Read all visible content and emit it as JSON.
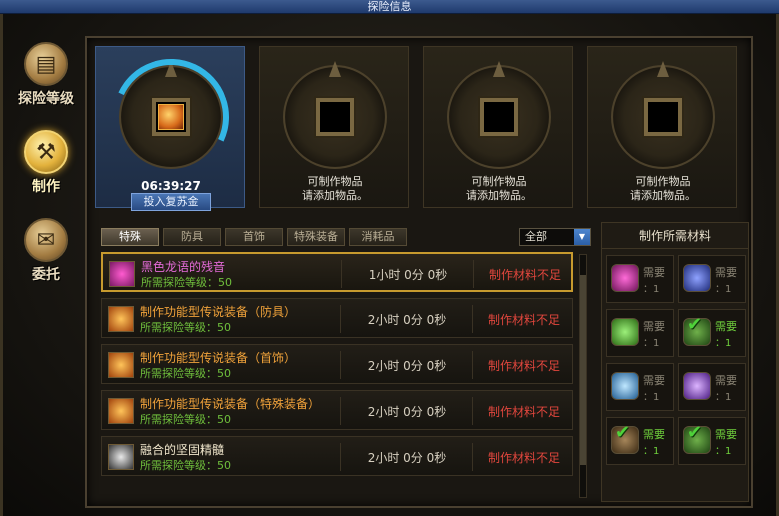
{
  "window": {
    "title": "探险信息"
  },
  "nav": [
    {
      "label": "探险等级",
      "icon": "scroll-icon",
      "active": false
    },
    {
      "label": "制作",
      "icon": "anvil-icon",
      "active": true
    },
    {
      "label": "委托",
      "icon": "envelope-icon",
      "active": false
    }
  ],
  "slots": [
    {
      "timer": "06:39:27",
      "button": "投入复苏金",
      "progress": 0.2
    },
    {
      "msg1": "可制作物品",
      "msg2": "请添加物品。"
    },
    {
      "msg1": "可制作物品",
      "msg2": "请添加物品。"
    },
    {
      "msg1": "可制作物品",
      "msg2": "请添加物品。"
    }
  ],
  "tabs": [
    "特殊",
    "防具",
    "首饰",
    "特殊装备",
    "消耗品"
  ],
  "filter": {
    "value": "全部"
  },
  "recipes": [
    {
      "name": "黑色龙语的残音",
      "level": "所需探险等级：50",
      "time": "1小时 0分 0秒",
      "status": "制作材料不足",
      "color": "#e46bd8"
    },
    {
      "name": "制作功能型传说装备（防具）",
      "level": "所需探险等级：50",
      "time": "2小时 0分 0秒",
      "status": "制作材料不足",
      "color": "#f0a23a"
    },
    {
      "name": "制作功能型传说装备（首饰）",
      "level": "所需探险等级：50",
      "time": "2小时 0分 0秒",
      "status": "制作材料不足",
      "color": "#f0a23a"
    },
    {
      "name": "制作功能型传说装备（特殊装备）",
      "level": "所需探险等级：50",
      "time": "2小时 0分 0秒",
      "status": "制作材料不足",
      "color": "#f0a23a"
    },
    {
      "name": "融合的坚固精髓",
      "level": "所需探险等级：50",
      "time": "2小时 0分 0秒",
      "status": "制作材料不足",
      "color": "#f0e6cc"
    }
  ],
  "materials": {
    "title": "制作所需材料",
    "items": [
      {
        "need": "需要",
        "count": "：1",
        "ok": false,
        "icon": "magenta-orb-icon",
        "color": "#c2379f"
      },
      {
        "need": "需要",
        "count": "：1",
        "ok": false,
        "icon": "blue-orb-icon",
        "color": "#4257b8"
      },
      {
        "need": "需要",
        "count": "：1",
        "ok": false,
        "icon": "green-orb-icon",
        "color": "#4f9b2c"
      },
      {
        "need": "需要",
        "count": "：1",
        "ok": true,
        "icon": "check-icon",
        "color": "#3b6b2a"
      },
      {
        "need": "需要",
        "count": "：1",
        "ok": false,
        "icon": "cyan-orb-icon",
        "color": "#3f85c9"
      },
      {
        "need": "需要",
        "count": "：1",
        "ok": false,
        "icon": "violet-orb-icon",
        "color": "#8a4fc9"
      },
      {
        "need": "需要",
        "count": "：1",
        "ok": true,
        "icon": "check-icon",
        "color": "#5a4a2a"
      },
      {
        "need": "需要",
        "count": "：1",
        "ok": true,
        "icon": "check-icon",
        "color": "#3b6b2a"
      }
    ]
  }
}
